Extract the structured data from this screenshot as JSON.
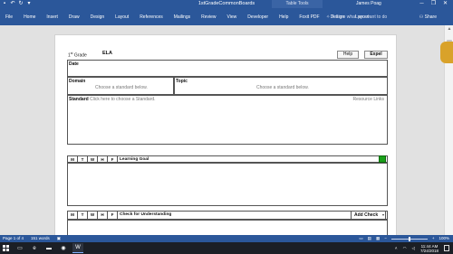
{
  "window": {
    "title": "1stGradeCommonBoards",
    "contextual_tab_group": "Table Tools",
    "user": "James Poag",
    "controls": [
      "─",
      "❐",
      "✕"
    ]
  },
  "ribbon": {
    "tabs": [
      "File",
      "Home",
      "Insert",
      "Draw",
      "Design",
      "Layout",
      "References",
      "Mailings",
      "Review",
      "View",
      "Developer",
      "Help",
      "Foxit PDF",
      "Design",
      "Layout"
    ],
    "tell_me": "Tell me what you want to do",
    "share": "Share"
  },
  "document": {
    "grade": "1",
    "grade_suffix": "st",
    "grade_word": "Grade",
    "subject": "ELA",
    "buttons": {
      "help": "Help",
      "expel": "Expel"
    },
    "date_label": "Date",
    "domain_label": "Domain",
    "domain_placeholder": "Choose a standard below.",
    "topic_label": "Topic",
    "topic_placeholder": "Choose a standard below.",
    "standard_label": "Standard",
    "standard_placeholder": "Click here to choose a Standard.",
    "resource_links": "Resource Links",
    "days": [
      "M",
      "T",
      "W",
      "H",
      "F"
    ],
    "learning_goal_label": "Learning Goal",
    "check_label": "Check for Understanding",
    "add_check": "Add Check",
    "accent_green": "#1aa01a"
  },
  "statusbar": {
    "page": "Page 1 of 4",
    "words": "151 words",
    "zoom": "100%"
  },
  "taskbar": {
    "time": "11:44 AM",
    "date": "7/24/2018"
  }
}
